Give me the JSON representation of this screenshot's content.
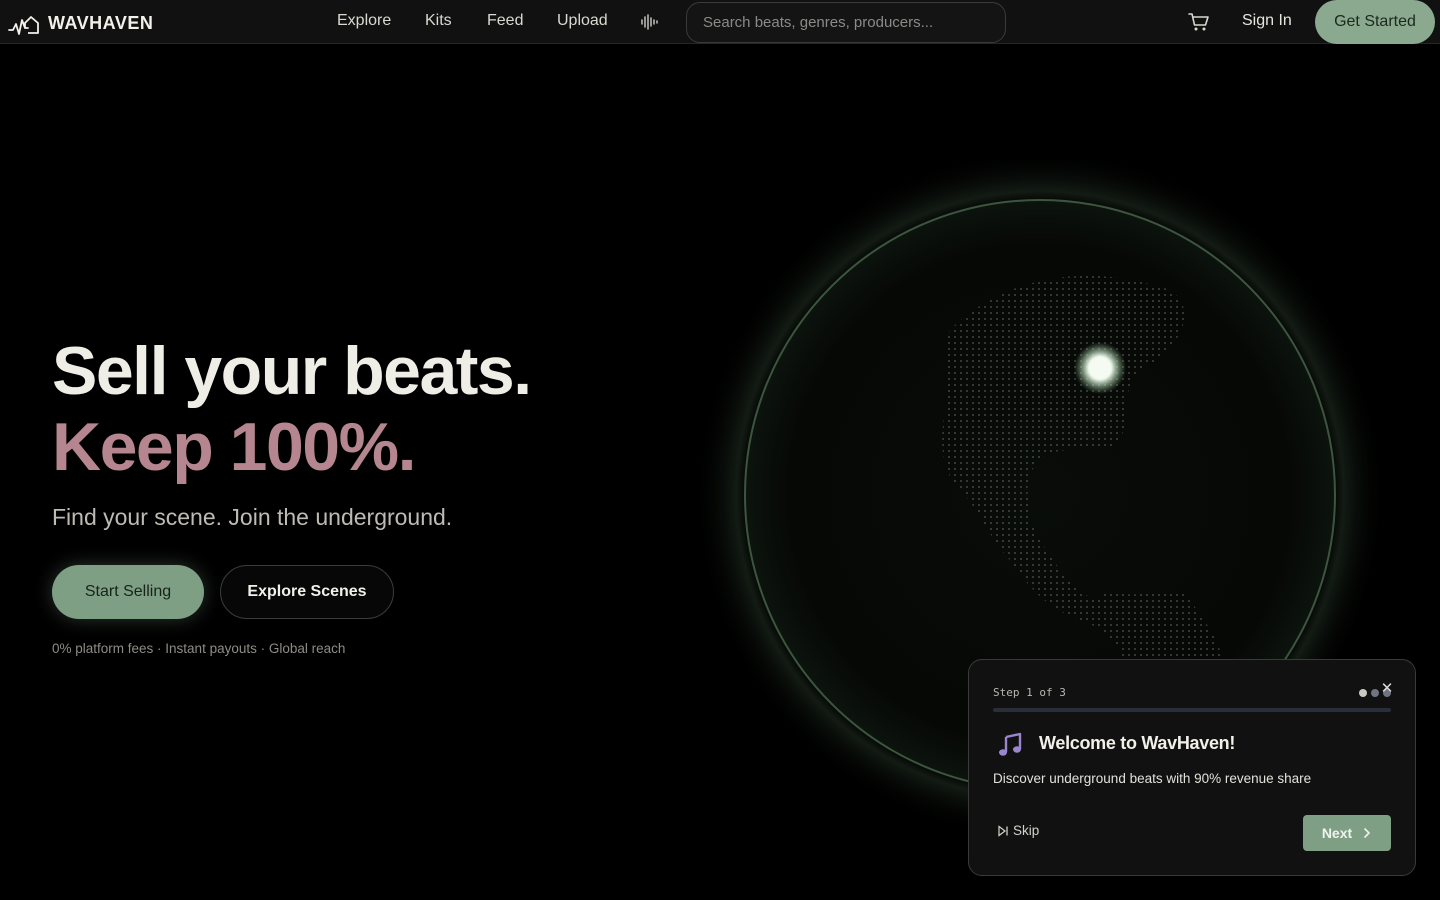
{
  "colors": {
    "accent_green": "#8ba98f",
    "accent_pink": "#b5868f",
    "background": "#000000",
    "globe_glow": "#5a7a5e"
  },
  "nav": {
    "brand": "WAVHAVEN",
    "brand_icon": "waveform-house-icon",
    "links": [
      "Explore",
      "Kits",
      "Feed",
      "Upload"
    ],
    "extra_icon": "audio-wave-icon",
    "search_placeholder": "Search beats, genres, producers...",
    "cart_icon": "cart-icon",
    "sign_in": "Sign In",
    "get_started": "Get Started"
  },
  "hero": {
    "headline_1": "Sell your beats.",
    "headline_2": "Keep 100%.",
    "subtitle": "Find your scene. Join the underground.",
    "primary_button": "Start Selling",
    "secondary_button": "Explore Scenes",
    "tagline": "0% platform fees · Instant payouts · Global reach"
  },
  "tour": {
    "step_label": "Step 1 of 3",
    "current_step": 1,
    "total_steps": 3,
    "title": "Welcome to WavHaven!",
    "description": "Discover underground beats with 90% revenue share",
    "skip": "Skip",
    "next": "Next",
    "icon": "music-note-icon"
  }
}
